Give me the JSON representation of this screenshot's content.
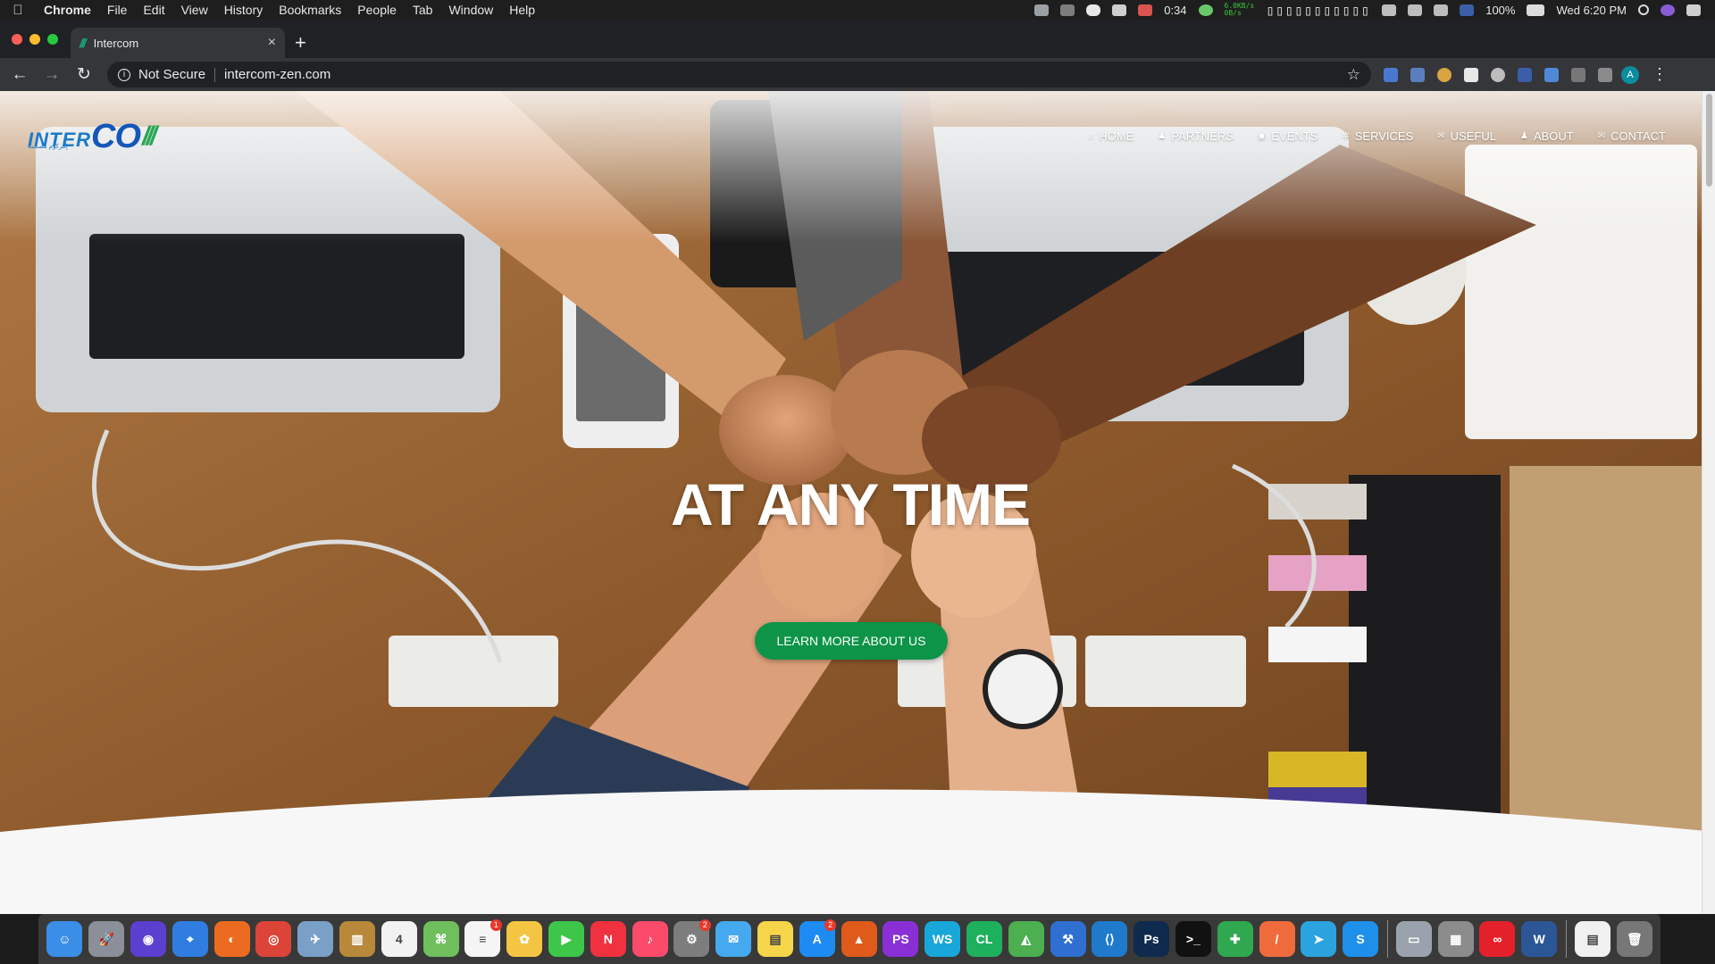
{
  "menubar": {
    "apple_icon": "apple-icon",
    "app_name": "Chrome",
    "items": [
      "File",
      "Edit",
      "View",
      "History",
      "Bookmarks",
      "People",
      "Tab",
      "Window",
      "Help"
    ],
    "timer": "0:34",
    "net_tx": "6.0KB/s",
    "net_rx": "0B/s",
    "battery": "100%",
    "clock": "Wed 6:20 PM"
  },
  "browser": {
    "tab_title": "Intercom",
    "tab_favicon": "///",
    "security_label": "Not Secure",
    "url": "intercom-zen.com",
    "profile_initial": "A"
  },
  "site": {
    "logo": {
      "part1": "INTER",
      "part2": "CO",
      "part3": "///",
      "tagline": "إنتركوم مصممة"
    },
    "nav": [
      {
        "label": "HOME",
        "icon": "home-icon",
        "glyph": "⌂"
      },
      {
        "label": "PARTNERS",
        "icon": "user-icon",
        "glyph": "♟"
      },
      {
        "label": "EVENTS",
        "icon": "image-icon",
        "glyph": "▣"
      },
      {
        "label": "SERVICES",
        "icon": "gear-icon",
        "glyph": "✲"
      },
      {
        "label": "USEFUL",
        "icon": "comments-icon",
        "glyph": "✉"
      },
      {
        "label": "ABOUT",
        "icon": "user-icon",
        "glyph": "♟"
      },
      {
        "label": "CONTACT",
        "icon": "envelope-icon",
        "glyph": "✉"
      }
    ],
    "hero_title": "AT ANY TIME",
    "cta_label": "LEARN MORE ABOUT US"
  },
  "colors": {
    "cta": "#0e9448",
    "logo_blue": "#1557b9",
    "logo_green": "#2aa655"
  },
  "dock": [
    {
      "name": "finder",
      "color": "#3a8ee6",
      "glyph": "☺"
    },
    {
      "name": "launchpad",
      "color": "#8a8f99",
      "glyph": "🚀"
    },
    {
      "name": "siri",
      "color": "#5b3fd0",
      "glyph": "◉"
    },
    {
      "name": "safari",
      "color": "#2f7de1",
      "glyph": "⌖"
    },
    {
      "name": "firefox",
      "color": "#ec6b21",
      "glyph": "◐"
    },
    {
      "name": "chrome",
      "color": "#db4437",
      "glyph": "◎"
    },
    {
      "name": "preview",
      "color": "#7aa0c8",
      "glyph": "✈"
    },
    {
      "name": "notebook",
      "color": "#b8893a",
      "glyph": "▥"
    },
    {
      "name": "calendar",
      "color": "#f2f2f2",
      "glyph": "4"
    },
    {
      "name": "maps",
      "color": "#6fbf5d",
      "glyph": "⌘"
    },
    {
      "name": "reminders",
      "color": "#f5f5f5",
      "glyph": "≡",
      "badge": "1"
    },
    {
      "name": "photos",
      "color": "#f4c542",
      "glyph": "✿"
    },
    {
      "name": "facetime",
      "color": "#3ec64a",
      "glyph": "▶"
    },
    {
      "name": "news",
      "color": "#f0313f",
      "glyph": "N"
    },
    {
      "name": "music",
      "color": "#fb4a6a",
      "glyph": "♪"
    },
    {
      "name": "system-preferences",
      "color": "#7d7d7d",
      "glyph": "⚙",
      "badge": "2"
    },
    {
      "name": "messages",
      "color": "#45a9ef",
      "glyph": "✉"
    },
    {
      "name": "notes",
      "color": "#f7d54a",
      "glyph": "▤"
    },
    {
      "name": "app-store",
      "color": "#1d8bf1",
      "glyph": "A",
      "badge": "2"
    },
    {
      "name": "matlab",
      "color": "#e05a1b",
      "glyph": "▲"
    },
    {
      "name": "phpstorm",
      "color": "#8a2fd6",
      "glyph": "PS"
    },
    {
      "name": "webstorm",
      "color": "#18a7d8",
      "glyph": "WS"
    },
    {
      "name": "clion",
      "color": "#1fb05e",
      "glyph": "CL"
    },
    {
      "name": "android-studio",
      "color": "#4caf50",
      "glyph": "◭"
    },
    {
      "name": "xcode",
      "color": "#2e6fd1",
      "glyph": "⚒"
    },
    {
      "name": "vscode",
      "color": "#1f7acc",
      "glyph": "⟨⟩"
    },
    {
      "name": "photoshop",
      "color": "#0e2a4d",
      "glyph": "Ps"
    },
    {
      "name": "terminal",
      "color": "#111111",
      "glyph": ">_"
    },
    {
      "name": "android-file",
      "color": "#2fa84f",
      "glyph": "✚"
    },
    {
      "name": "swift-playgrounds",
      "color": "#f06b3c",
      "glyph": "/"
    },
    {
      "name": "telegram",
      "color": "#2aa3de",
      "glyph": "➤"
    },
    {
      "name": "skype",
      "color": "#1e90ea",
      "glyph": "S"
    },
    {
      "name": "image-capture",
      "color": "#9aa3ad",
      "glyph": "▭"
    },
    {
      "name": "archive",
      "color": "#8c8c8c",
      "glyph": "▦"
    },
    {
      "name": "creative-cloud",
      "color": "#e4212b",
      "glyph": "∞"
    },
    {
      "name": "word",
      "color": "#2b5797",
      "glyph": "W"
    },
    {
      "name": "docs",
      "color": "#f0f0f0",
      "glyph": "▤"
    },
    {
      "name": "trash",
      "color": "#777777",
      "glyph": "🗑"
    }
  ]
}
